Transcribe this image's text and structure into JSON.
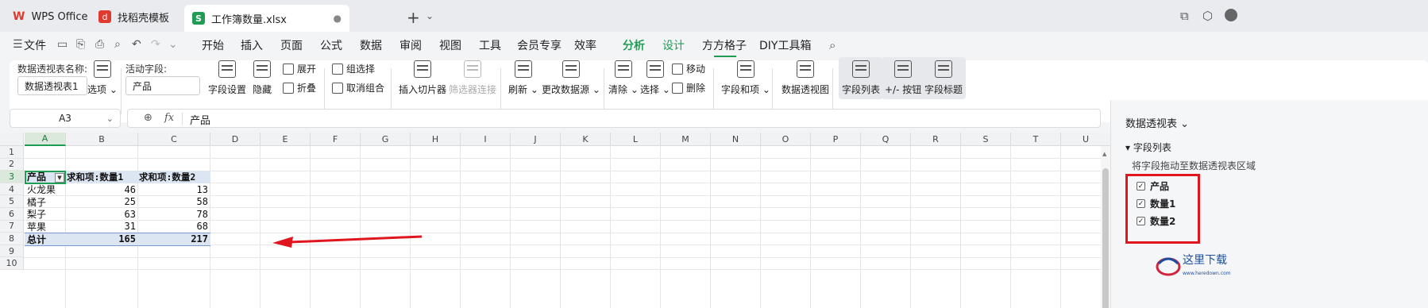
{
  "tabs": [
    {
      "label": "WPS Office"
    },
    {
      "label": "找稻壳模板"
    },
    {
      "label": "工作簿数量.xlsx",
      "close": "●"
    }
  ],
  "window_controls": {
    "caret": "⌄"
  },
  "menu": {
    "file": "文件",
    "items": [
      "开始",
      "插入",
      "页面",
      "公式",
      "数据",
      "审阅",
      "视图",
      "工具",
      "会员专享",
      "效率",
      "分析",
      "设计",
      "方方格子",
      "DIY工具箱"
    ],
    "active": "分析"
  },
  "ribbon": {
    "pivot_name_label": "数据透视表名称:",
    "pivot_name_value": "数据透视表1",
    "options_btn": "选项",
    "active_field_label": "活动字段:",
    "active_field_value": "产品",
    "field_settings": "字段设置",
    "hide": "隐藏",
    "expand": "展开",
    "collapse": "折叠",
    "group_select": "组选择",
    "ungroup": "取消组合",
    "insert_slicer": "插入切片器",
    "filter_connect": "筛选器连接",
    "refresh": "刷新",
    "change_source": "更改数据源",
    "clear": "清除",
    "select": "选择",
    "move": "移动",
    "delete": "删除",
    "fields_items": "字段和项",
    "pivot_chart": "数据透视图",
    "field_list": "字段列表",
    "plus_minus": "+/- 按钮",
    "field_headers": "字段标题"
  },
  "formula_bar": {
    "cell_ref": "A3",
    "content": "产品"
  },
  "grid": {
    "columns": [
      "A",
      "B",
      "C",
      "D",
      "E",
      "F",
      "G",
      "H",
      "I",
      "J",
      "K",
      "L",
      "M",
      "N",
      "O",
      "P",
      "Q",
      "R",
      "S",
      "T",
      "U"
    ],
    "rows": [
      "1",
      "2",
      "3",
      "4",
      "5",
      "6",
      "7",
      "8",
      "9",
      "10"
    ],
    "pivot": {
      "headers": [
        "产品",
        "求和项:数量1",
        "求和项:数量2"
      ],
      "data": [
        [
          "火龙果",
          "46",
          "13"
        ],
        [
          "橘子",
          "25",
          "58"
        ],
        [
          "梨子",
          "63",
          "78"
        ],
        [
          "苹果",
          "31",
          "68"
        ]
      ],
      "total": [
        "总计",
        "165",
        "217"
      ]
    }
  },
  "panel": {
    "title": "数据透视表",
    "section": "字段列表",
    "hint": "将字段拖动至数据透视表区域",
    "fields": [
      {
        "name": "产品",
        "checked": true
      },
      {
        "name": "数量1",
        "checked": true
      },
      {
        "name": "数量2",
        "checked": true
      }
    ]
  },
  "watermark": {
    "title": "这里下载",
    "url": "www.heredown.com"
  },
  "colors": {
    "accent": "#1f9d55",
    "pivot_header_bg": "#dce5f2",
    "annotation": "#e0161f"
  }
}
